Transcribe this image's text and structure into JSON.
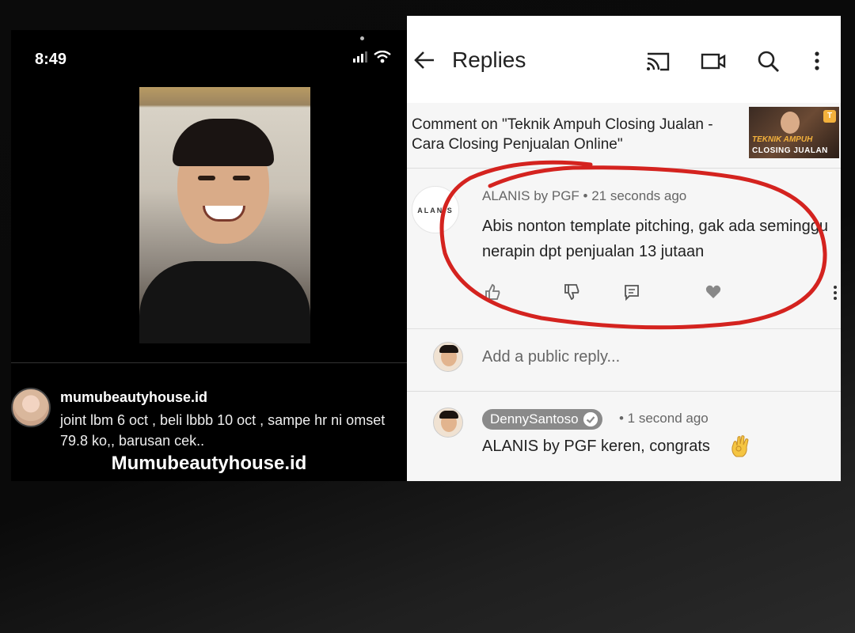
{
  "left": {
    "status_time": "8:49",
    "username": "mumubeautyhouse.id",
    "comment": "joint lbm 6 oct , beli lbbb 10 oct , sampe hr ni omset 79.8 ko,, barusan cek..",
    "caption": "Mumubeautyhouse.id"
  },
  "right": {
    "title": "Replies",
    "comment_on": "Comment on \"Teknik Ampuh Closing Jualan - Cara Closing Penjualan Online\"",
    "thumb": {
      "line1": "TEKNIK AMPUH",
      "line2": "CLOSING JUALAN",
      "badge": "T"
    },
    "comment": {
      "logo_text": "ALANIS",
      "meta": "ALANIS by PGF • 21 seconds ago",
      "text": "Abis nonton template pitching, gak ada seminggu nerapin dpt penjualan 13 jutaan"
    },
    "reply_placeholder": "Add a public reply...",
    "reply": {
      "author": "DennySantoso",
      "time": "• 1 second ago",
      "text": "ALANIS by PGF keren, congrats"
    },
    "icons": [
      "back-arrow-icon",
      "cast-icon",
      "video-camera-icon",
      "search-icon",
      "more-vert-icon",
      "like-icon",
      "dislike-icon",
      "reply-icon",
      "heart-icon",
      "ok-hand-emoji-icon",
      "verified-check-icon"
    ],
    "colors": {
      "annotation_red": "#d4231f",
      "badge_gray": "#8a8a8a"
    }
  }
}
